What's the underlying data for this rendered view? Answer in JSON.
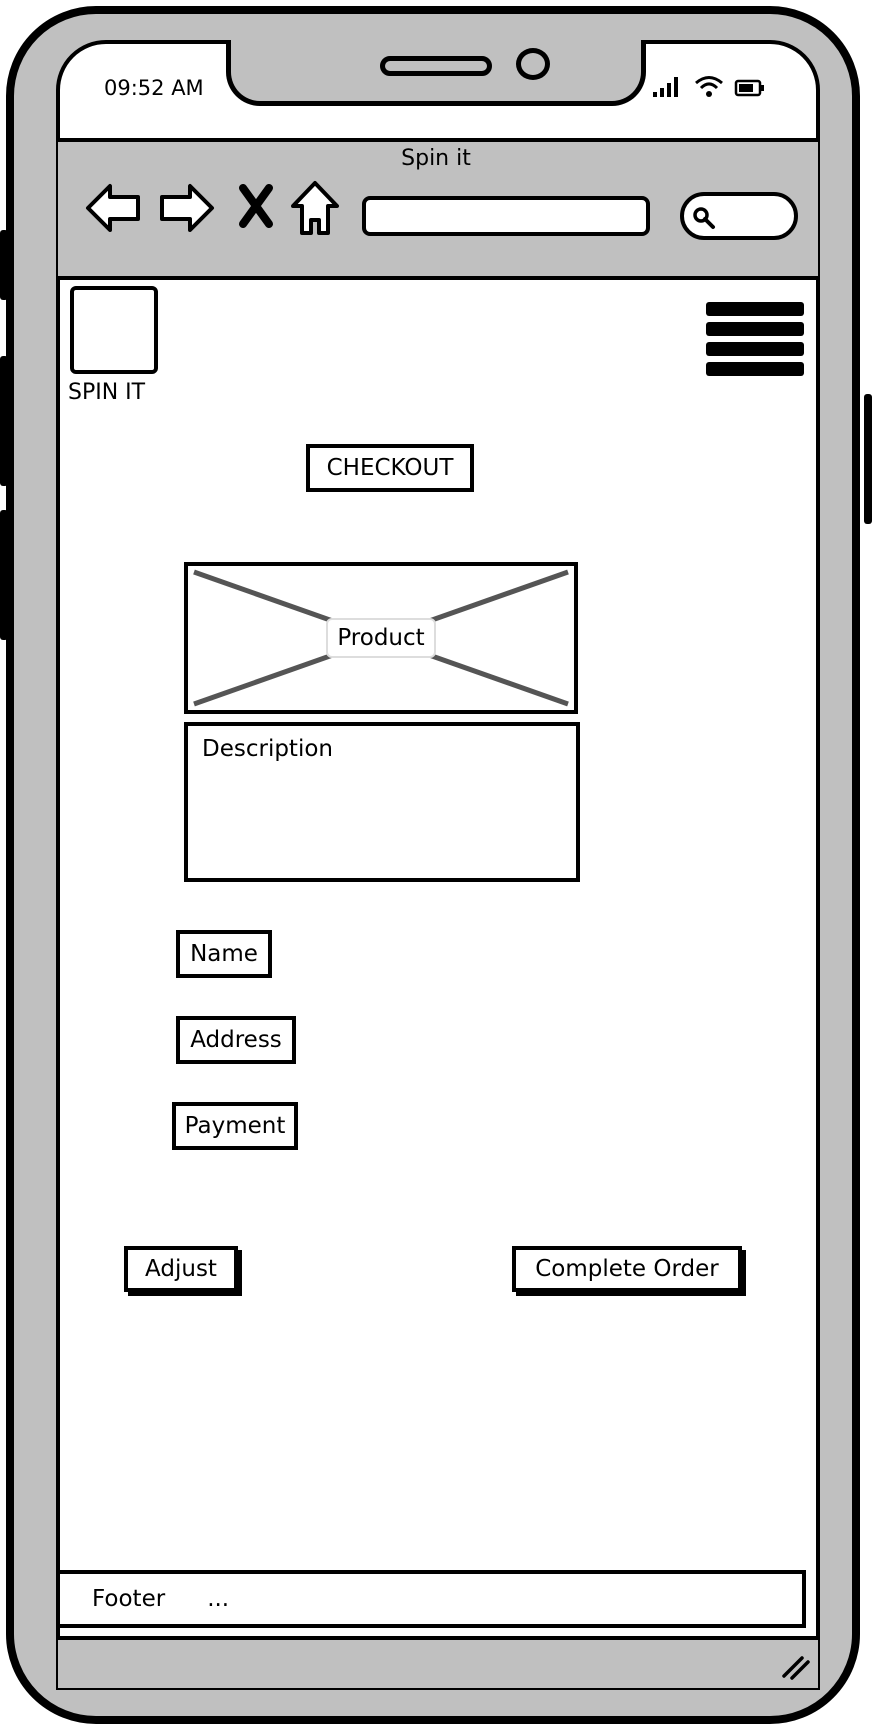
{
  "status_bar": {
    "time": "09:52 AM",
    "icons": [
      "signal-icon",
      "wifi-icon",
      "battery-icon"
    ]
  },
  "browser": {
    "title": "Spin it",
    "nav_icons": [
      "back-arrow-icon",
      "forward-arrow-icon",
      "close-icon",
      "home-icon"
    ],
    "url_value": "",
    "search_icon": "search-icon"
  },
  "header": {
    "logo_text": "SPIN IT",
    "menu_icon": "hamburger-menu-icon"
  },
  "main": {
    "checkout_label": "CHECKOUT",
    "product_label": "Product",
    "description_label": "Description",
    "fields": {
      "name": "Name",
      "address": "Address",
      "payment": "Payment"
    },
    "adjust_label": "Adjust",
    "complete_label": "Complete Order"
  },
  "footer": {
    "label": "Footer",
    "ellipsis": "..."
  },
  "colors": {
    "frame": "#000000",
    "chrome_gray": "#c0c0c0",
    "screen_bg": "#ffffff",
    "placeholder_line": "#555555"
  }
}
